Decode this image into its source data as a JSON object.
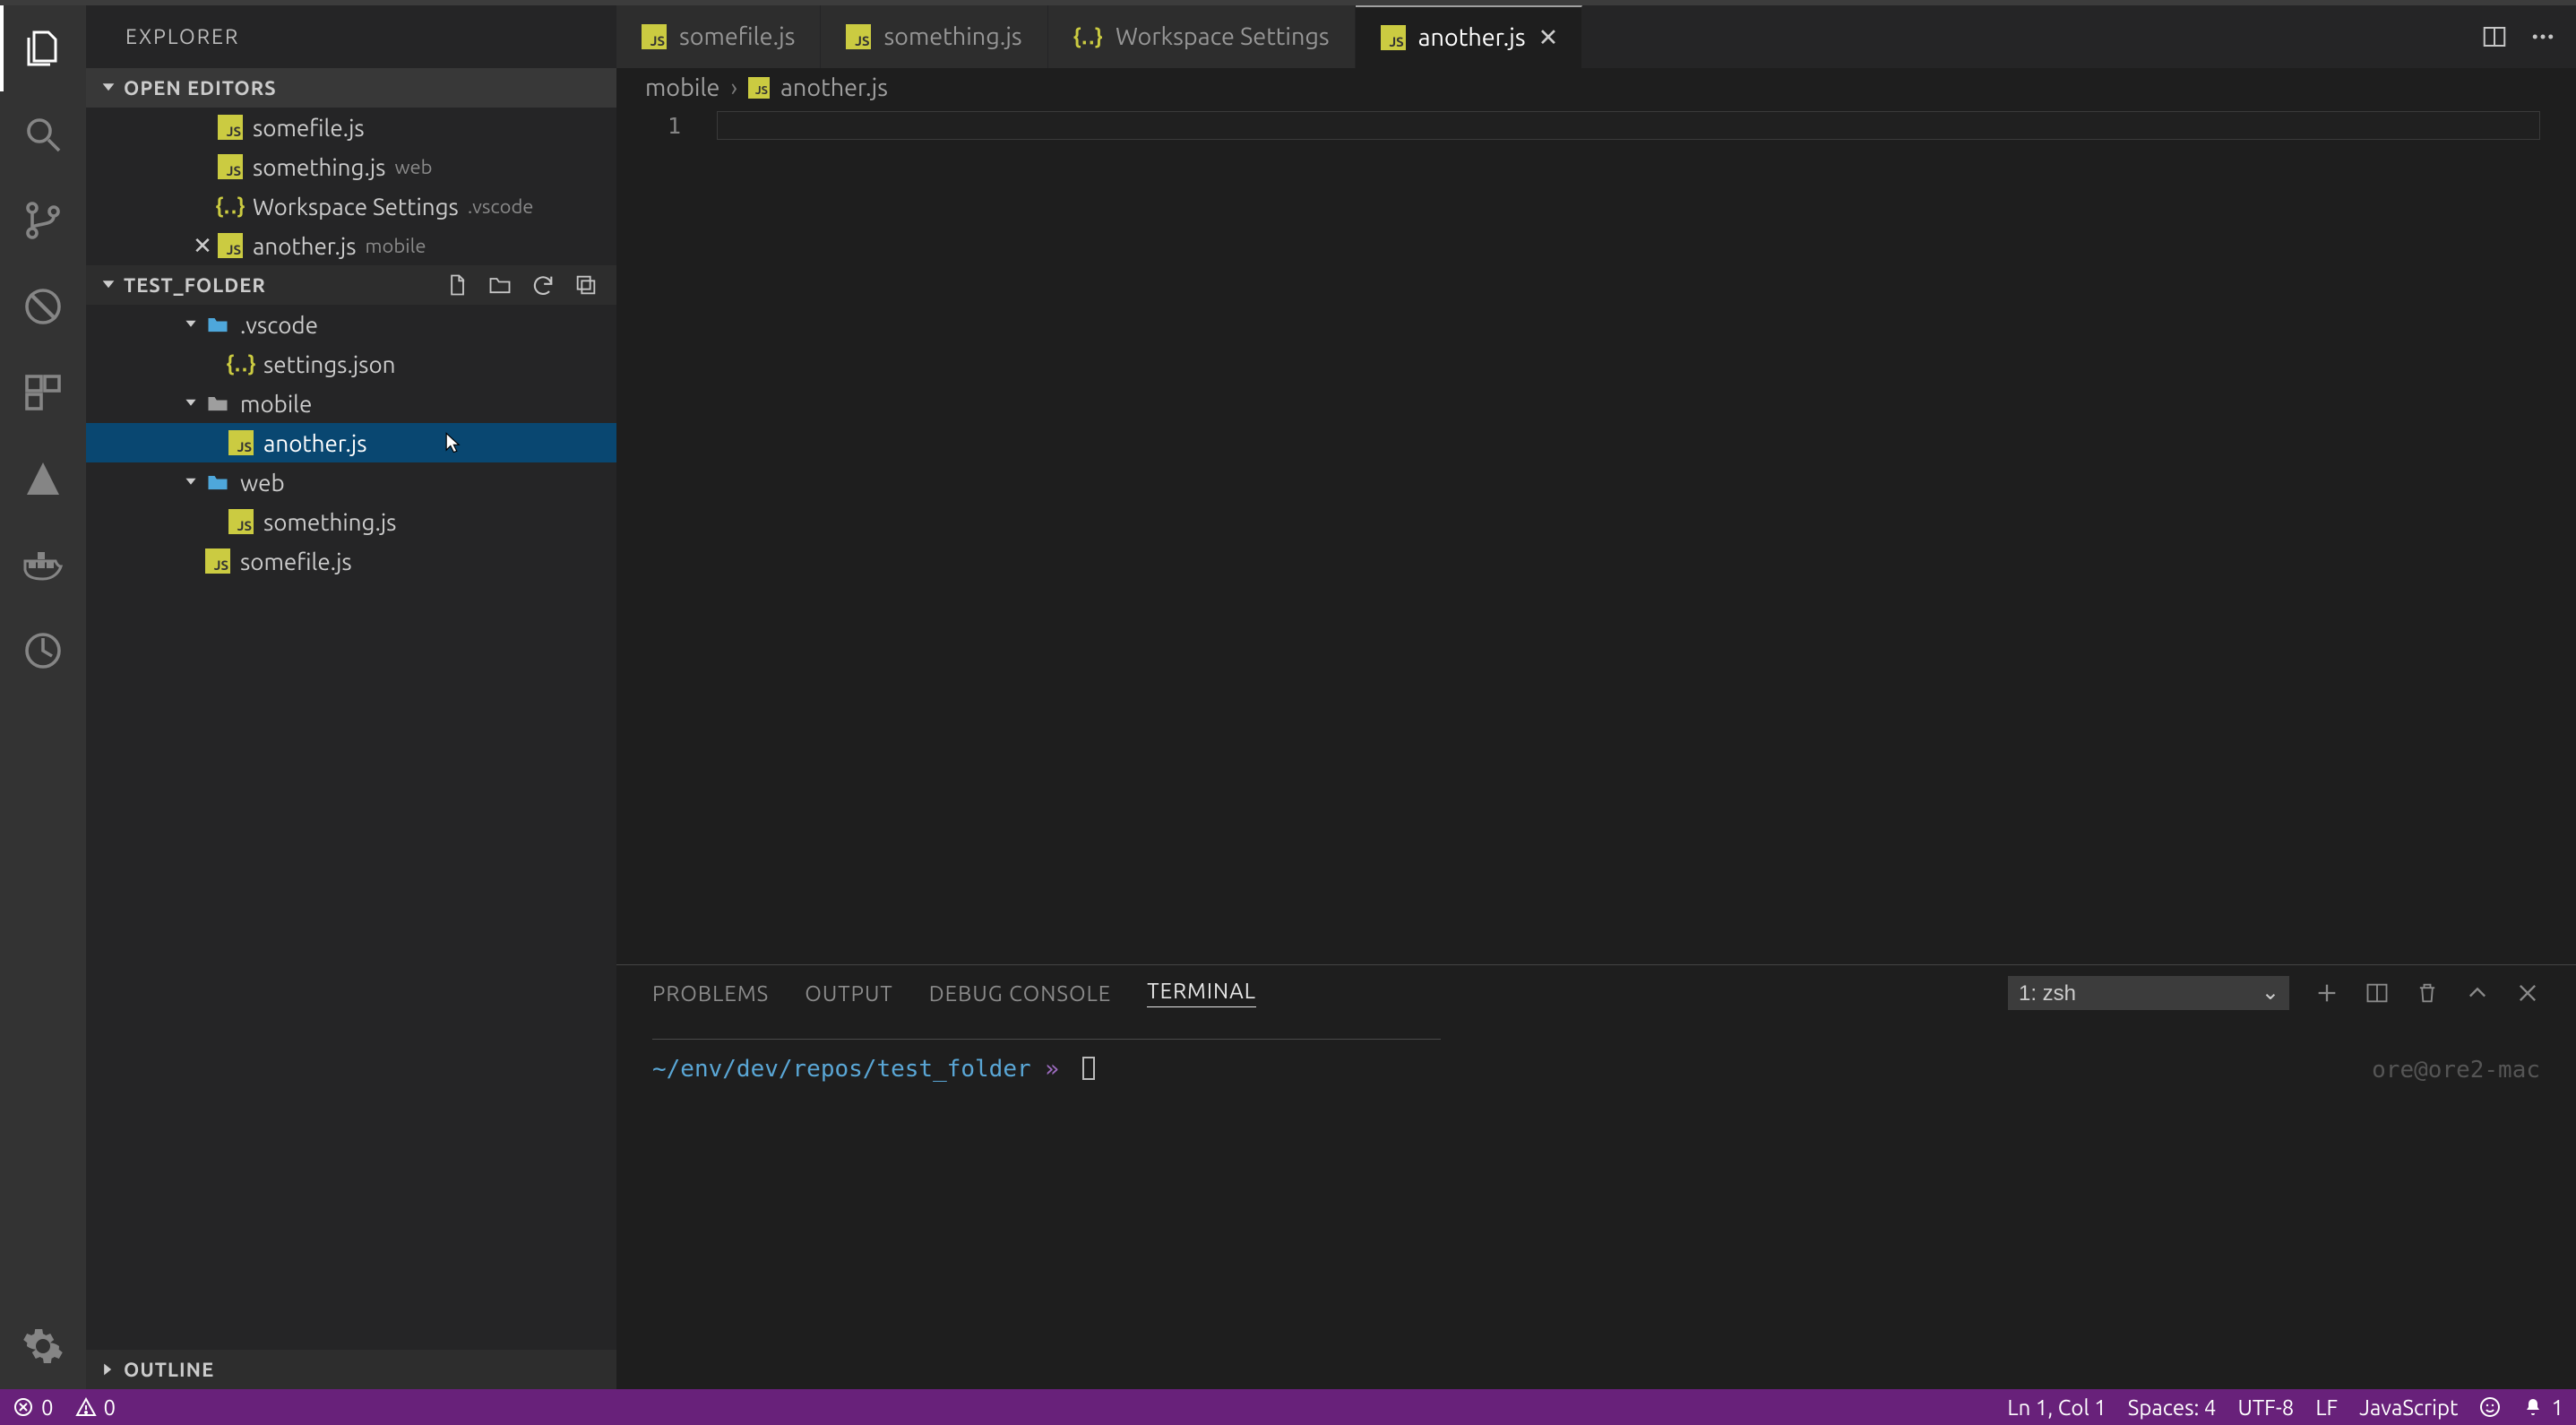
{
  "sidebar": {
    "title": "EXPLORER",
    "open_editors_label": "OPEN EDITORS",
    "outline_label": "OUTLINE",
    "open_editors": [
      {
        "name": "somefile.js",
        "icon": "js",
        "hint": ""
      },
      {
        "name": "something.js",
        "icon": "js",
        "hint": "web"
      },
      {
        "name": "Workspace Settings",
        "icon": "json",
        "hint": ".vscode"
      },
      {
        "name": "another.js",
        "icon": "js",
        "hint": "mobile",
        "close": true
      }
    ],
    "workspace_label": "TEST_FOLDER",
    "tree_vscode": ".vscode",
    "tree_settings": "settings.json",
    "tree_mobile": "mobile",
    "tree_another": "another.js",
    "tree_web": "web",
    "tree_something": "something.js",
    "tree_somefile": "somefile.js"
  },
  "tabs": [
    {
      "name": "somefile.js",
      "icon": "js",
      "active": false
    },
    {
      "name": "something.js",
      "icon": "js",
      "active": false
    },
    {
      "name": "Workspace Settings",
      "icon": "json",
      "active": false
    },
    {
      "name": "another.js",
      "icon": "js",
      "active": true
    }
  ],
  "breadcrumb": {
    "folder": "mobile",
    "file": "another.js"
  },
  "editor": {
    "line_number": "1"
  },
  "panel": {
    "tabs": {
      "problems": "PROBLEMS",
      "output": "OUTPUT",
      "debug": "DEBUG CONSOLE",
      "terminal": "TERMINAL"
    },
    "terminal_select": "1: zsh",
    "prompt_path": "~/env/dev/repos/test_folder",
    "prompt_sep": "»",
    "host": "ore@ore2-mac"
  },
  "status": {
    "errors": "0",
    "warnings": "0",
    "ln_col": "Ln 1, Col 1",
    "spaces": "Spaces: 4",
    "encoding": "UTF-8",
    "eol": "LF",
    "lang": "JavaScript",
    "notif": "1"
  }
}
